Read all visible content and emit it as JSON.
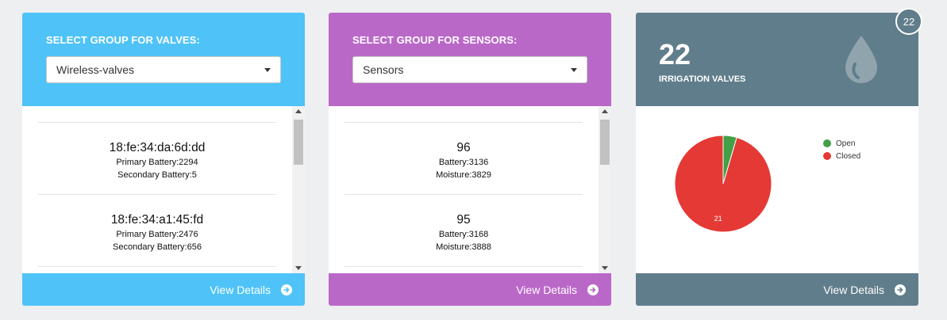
{
  "valves_card": {
    "header_title": "SELECT GROUP FOR VALVES:",
    "select_value": "Wireless-valves",
    "items": [
      {
        "title": "18:fe:34:da:6d:dd",
        "line1": "Primary Battery:2294",
        "line2": "Secondary Battery:5"
      },
      {
        "title": "18:fe:34:a1:45:fd",
        "line1": "Primary Battery:2476",
        "line2": "Secondary Battery:656"
      }
    ],
    "footer_label": "View Details",
    "color": "#4fc3f7"
  },
  "sensors_card": {
    "header_title": "SELECT GROUP FOR SENSORS:",
    "select_value": "Sensors",
    "items": [
      {
        "title": "96",
        "line1": "Battery:3136",
        "line2": "Moisture:3829"
      },
      {
        "title": "95",
        "line1": "Battery:3168",
        "line2": "Moisture:3888"
      }
    ],
    "footer_label": "View Details",
    "color": "#ba68c8"
  },
  "irrigation_card": {
    "count": "22",
    "label": "IRRIGATION VALVES",
    "badge": "22",
    "footer_label": "View Details",
    "color": "#607d8b",
    "icon": "water-drop-icon"
  },
  "chart_data": {
    "type": "pie",
    "series": [
      {
        "name": "Open",
        "value": 1,
        "color": "#43a047"
      },
      {
        "name": "Closed",
        "value": 21,
        "color": "#e53935"
      }
    ],
    "data_labels": [
      "",
      "21"
    ],
    "legend_position": "top-right"
  }
}
